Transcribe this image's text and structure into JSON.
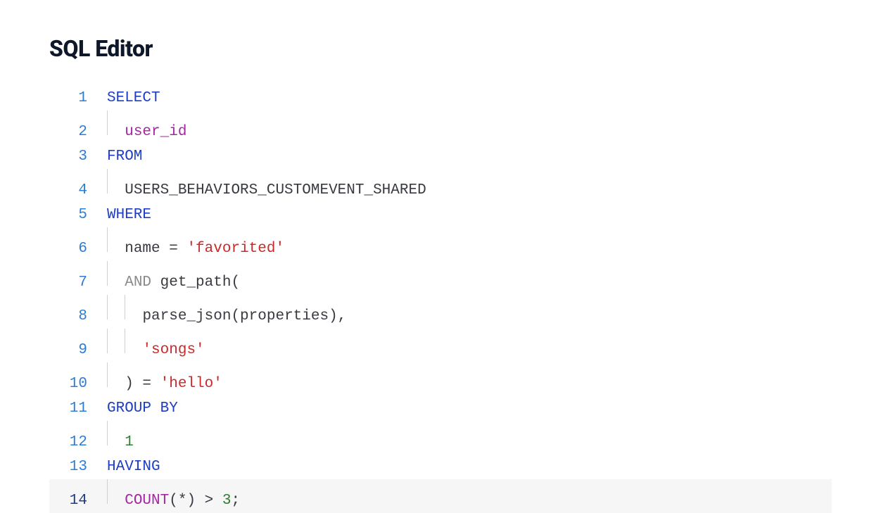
{
  "title": "SQL Editor",
  "cursor_line": 14,
  "code": {
    "l1": {
      "kw": "SELECT"
    },
    "l2": {
      "ident": "user_id"
    },
    "l3": {
      "kw": "FROM"
    },
    "l4": {
      "table": "USERS_BEHAVIORS_CUSTOMEVENT_SHARED"
    },
    "l5": {
      "kw": "WHERE"
    },
    "l6": {
      "col": "name",
      "op": " = ",
      "str": "'favorited'"
    },
    "l7": {
      "and": "AND",
      "fn": " get_path("
    },
    "l8": {
      "fn": "parse_json(properties),"
    },
    "l9": {
      "str": "'songs'"
    },
    "l10": {
      "close": ")",
      "op": " = ",
      "str": "'hello'"
    },
    "l11": {
      "kw": "GROUP BY"
    },
    "l12": {
      "num": "1"
    },
    "l13": {
      "kw": "HAVING"
    },
    "l14": {
      "fn": "COUNT",
      "paren_open": "(",
      "star": "*",
      "paren_close": ")",
      "op": " > ",
      "num": "3",
      "semi": ";"
    }
  },
  "line_numbers": {
    "n1": "1",
    "n2": "2",
    "n3": "3",
    "n4": "4",
    "n5": "5",
    "n6": "6",
    "n7": "7",
    "n8": "8",
    "n9": "9",
    "n10": "10",
    "n11": "11",
    "n12": "12",
    "n13": "13",
    "n14": "14"
  }
}
